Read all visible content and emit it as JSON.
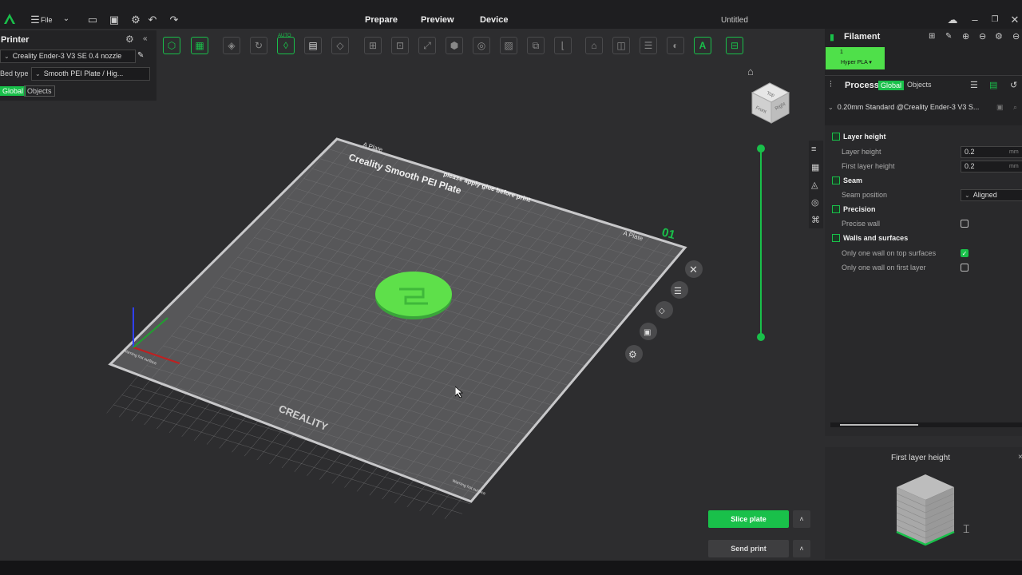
{
  "topbar": {
    "file_label": "File",
    "tabs": [
      "Prepare",
      "Preview",
      "Device"
    ],
    "title": "Untitled"
  },
  "left_panel": {
    "printer_title": "Printer",
    "printer_name": "Creality Ender-3 V3 SE 0.4 nozzle",
    "bed_type_label": "Bed type",
    "bed_type_value": "Smooth PEI Plate / Hig...",
    "global_label": "Global",
    "objects_label": "Objects"
  },
  "toolbar": {
    "auto_label": "AUTO"
  },
  "plate": {
    "brand_text": "Creality Smooth PEI Plate",
    "glue_text": "please apply glue before print",
    "plate_tag": "A Plate",
    "logo_text": "CREALITY",
    "warning_text": "Warning hot surface",
    "plate_number": "01"
  },
  "view_cube": {
    "top": "Top",
    "front": "Front",
    "right": "Right"
  },
  "right_panel": {
    "filament_title": "Filament",
    "filament_slot_number": "1",
    "filament_slot_name": "Hyper PLA ▾",
    "process_title": "Process",
    "global_label": "Global",
    "objects_label": "Objects",
    "preset": "0.20mm Standard @Creality Ender-3 V3 S...",
    "sections": {
      "layer_height": "Layer height",
      "layer_height_row": "Layer height",
      "layer_height_value": "0.2",
      "first_layer_height_row": "First layer height",
      "first_layer_height_value": "0.2",
      "unit": "mm",
      "seam": "Seam",
      "seam_position_row": "Seam position",
      "seam_position_value": "Aligned",
      "precision": "Precision",
      "precise_wall_row": "Precise wall",
      "walls": "Walls and surfaces",
      "one_wall_top_row": "Only one wall on top surfaces",
      "one_wall_first_row": "Only one wall on first layer"
    },
    "checkboxes": {
      "precise_wall": false,
      "one_wall_top": true,
      "one_wall_first": false
    }
  },
  "help_card": {
    "title": "First layer height"
  },
  "actions": {
    "slice_label": "Slice plate",
    "send_label": "Send print",
    "caret": "˄"
  },
  "colors": {
    "accent": "#19c04a",
    "background": "#2d2d2f",
    "panel": "#232325"
  }
}
